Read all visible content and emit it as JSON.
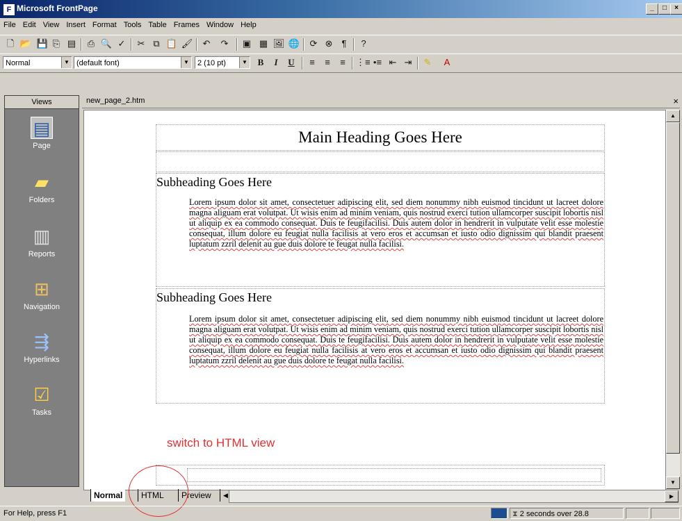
{
  "window": {
    "title": "Microsoft FrontPage",
    "controls": [
      "_",
      "□",
      "×"
    ]
  },
  "menu": [
    "File",
    "Edit",
    "View",
    "Insert",
    "Format",
    "Tools",
    "Table",
    "Frames",
    "Window",
    "Help"
  ],
  "format_toolbar": {
    "style": "Normal",
    "font": "(default font)",
    "size": "2  (10 pt)",
    "bold": "B",
    "italic": "I",
    "underline": "U"
  },
  "views": {
    "header": "Views",
    "items": [
      {
        "label": "Page",
        "icon": "page-icon"
      },
      {
        "label": "Folders",
        "icon": "folder-icon"
      },
      {
        "label": "Reports",
        "icon": "reports-icon"
      },
      {
        "label": "Navigation",
        "icon": "navigation-icon"
      },
      {
        "label": "Hyperlinks",
        "icon": "hyperlinks-icon"
      },
      {
        "label": "Tasks",
        "icon": "tasks-icon"
      }
    ]
  },
  "document": {
    "filename": "new_page_2.htm",
    "main_heading": "Main Heading Goes Here",
    "sections": [
      {
        "subheading": "Subheading Goes Here",
        "body": "Lorem ipsum dolor sit amet, consectetuer adipiscing elit, sed diem nonummy nibh euismod tincidunt ut lacreet dolore magna aliguam erat volutpat. Ut wisis enim ad minim veniam, quis nostrud exerci tution ullamcorper suscipit lobortis nisl ut aliquip ex ea commodo consequat. Duis te feugifacilisi. Duis autem dolor in hendrerit in vulputate velit esse molestie consequat, illum dolore eu feugiat nulla facilisis at vero eros et accumsan et iusto odio dignissim qui blandit praesent luptatum zzril delenit au gue duis dolore te feugat nulla facilisi."
      },
      {
        "subheading": "Subheading Goes Here",
        "body": "Lorem ipsum dolor sit amet, consectetuer adipiscing elit, sed diem nonummy nibh euismod tincidunt ut lacreet dolore magna aliguam erat volutpat. Ut wisis enim ad minim veniam, quis nostrud exerci tution ullamcorper suscipit lobortis nisl ut aliquip ex ea commodo consequat. Duis te feugifacilisi. Duis autem dolor in hendrerit in vulputate velit esse molestie consequat, illum dolore eu feugiat nulla facilisis at vero eros et accumsan et iusto odio dignissim qui blandit praesent luptatum zzril delenit au gue duis dolore te feugat nulla facilisi."
      }
    ]
  },
  "annotation": {
    "text": "switch to HTML view",
    "color": "#e03030"
  },
  "tabs": [
    "Normal",
    "HTML",
    "Preview"
  ],
  "status": {
    "help": "For Help, press F1",
    "download": "2 seconds over 28.8"
  }
}
